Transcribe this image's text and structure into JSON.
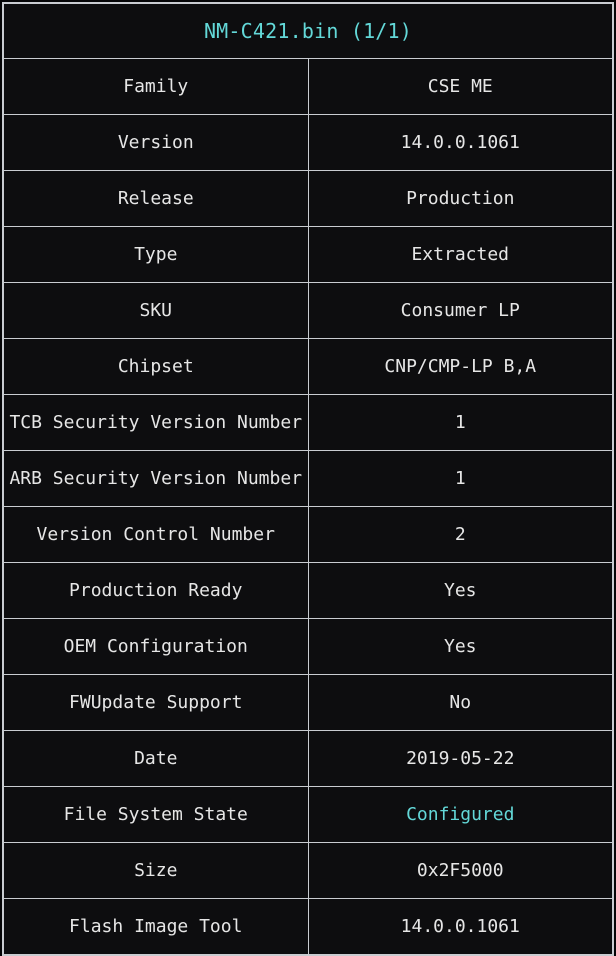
{
  "report": {
    "title": "NM-C421.bin (1/1)",
    "title_color": "#63d8d8",
    "accent_color": "#63d8d8",
    "text_color": "#e6e6e6",
    "border_color": "#c9ccd1",
    "cell_background": "#0d0d0f",
    "page_background": "#050507",
    "rows": [
      {
        "label": "Family",
        "value": "CSE ME"
      },
      {
        "label": "Version",
        "value": "14.0.0.1061"
      },
      {
        "label": "Release",
        "value": "Production"
      },
      {
        "label": "Type",
        "value": "Extracted"
      },
      {
        "label": "SKU",
        "value": "Consumer LP"
      },
      {
        "label": "Chipset",
        "value": "CNP/CMP-LP B,A"
      },
      {
        "label": "TCB Security Version Number",
        "value": "1"
      },
      {
        "label": "ARB Security Version Number",
        "value": "1"
      },
      {
        "label": "Version Control Number",
        "value": "2"
      },
      {
        "label": "Production Ready",
        "value": "Yes"
      },
      {
        "label": "OEM Configuration",
        "value": "Yes"
      },
      {
        "label": "FWUpdate Support",
        "value": "No"
      },
      {
        "label": "Date",
        "value": "2019-05-22"
      },
      {
        "label": "File System State",
        "value": "Configured",
        "accent": true
      },
      {
        "label": "Size",
        "value": "0x2F5000"
      },
      {
        "label": "Flash Image Tool",
        "value": "14.0.0.1061"
      }
    ]
  }
}
